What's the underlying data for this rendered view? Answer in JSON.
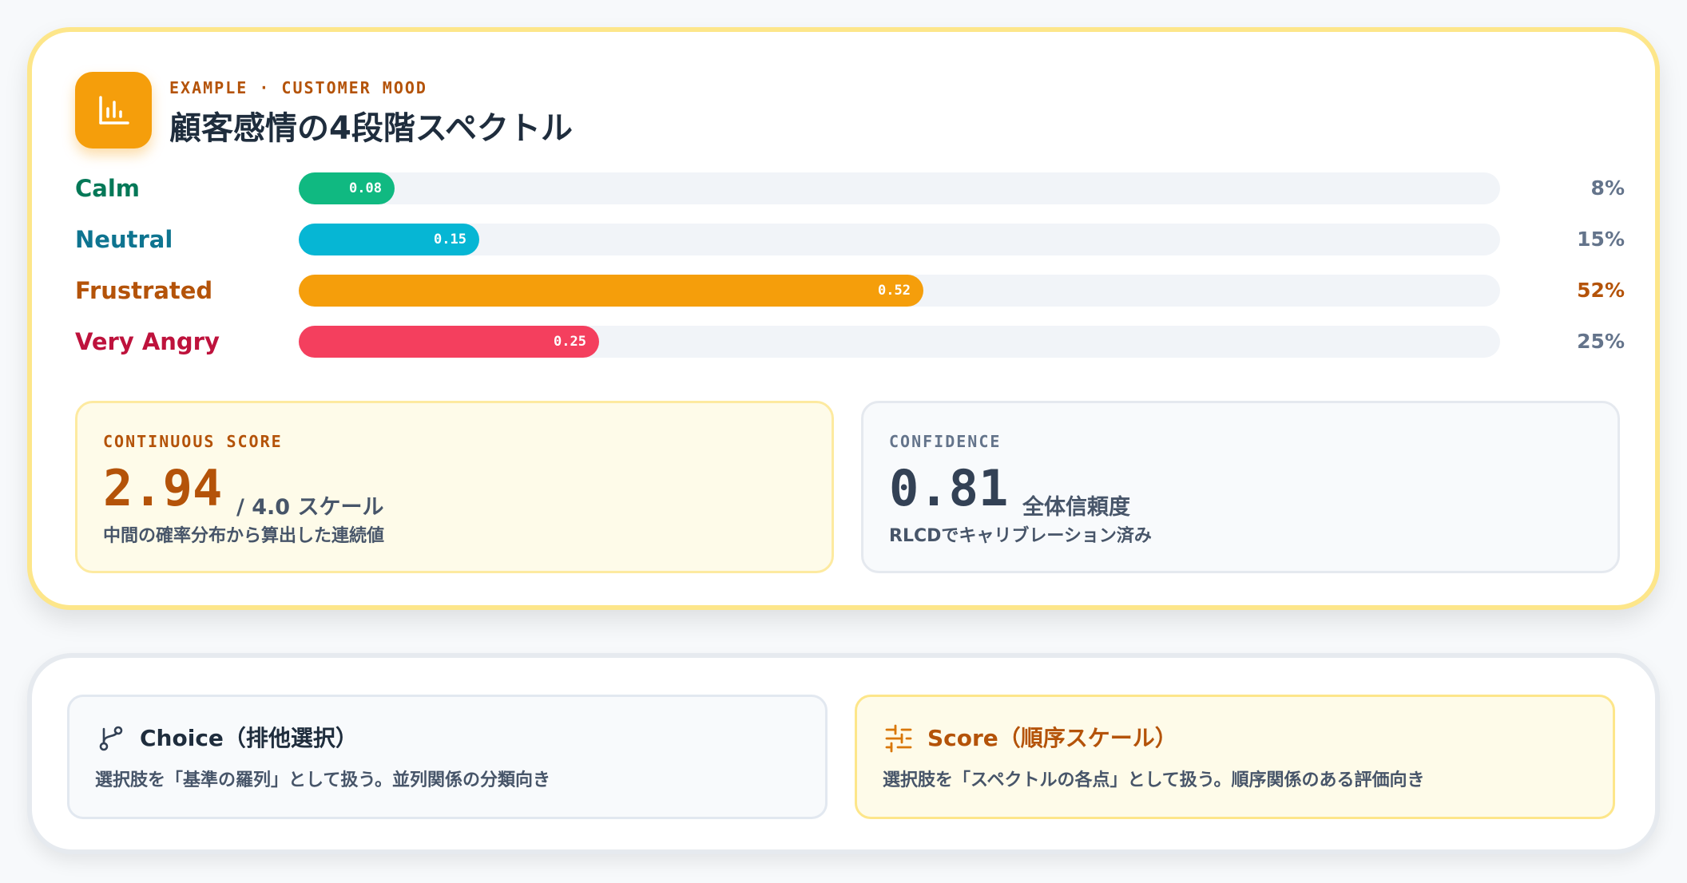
{
  "header": {
    "eyebrow": "EXAMPLE · CUSTOMER MOOD",
    "title": "顧客感情の4段階スペクトル",
    "icon": "bar-chart-icon"
  },
  "chart_data": {
    "type": "bar",
    "orientation": "horizontal",
    "categories": [
      "Calm",
      "Neutral",
      "Frustrated",
      "Very Angry"
    ],
    "values": [
      0.08,
      0.15,
      0.52,
      0.25
    ],
    "value_labels": [
      "0.08",
      "0.15",
      "0.52",
      "0.25"
    ],
    "percent_labels": [
      "8%",
      "15%",
      "52%",
      "25%"
    ],
    "xlim": [
      0,
      1
    ],
    "colors": [
      "#10b981",
      "#06b6d4",
      "#f59e0b",
      "#f43f5e"
    ],
    "label_colors": [
      "#047857",
      "#0e7490",
      "#b45309",
      "#be123c"
    ],
    "percent_colors": [
      "#64748b",
      "#64748b",
      "#b45309",
      "#64748b"
    ]
  },
  "score": {
    "label": "CONTINUOUS SCORE",
    "value": "2.94",
    "unit": "/ 4.0 スケール",
    "description": "中間の確率分布から算出した連続値"
  },
  "confidence": {
    "label": "CONFIDENCE",
    "value": "0.81",
    "unit": "全体信頼度",
    "description": "RLCDでキャリブレーション済み"
  },
  "modes": {
    "choice": {
      "icon": "branch-icon",
      "title": "Choice（排他選択）",
      "description": "選択肢を「基準の羅列」として扱う。並列関係の分類向き"
    },
    "score": {
      "icon": "sliders-icon",
      "title": "Score（順序スケール）",
      "description": "選択肢を「スペクトルの各点」として扱う。順序関係のある評価向き"
    }
  },
  "colors": {
    "accent": "#f59e0b",
    "accent_dark": "#b45309",
    "card_border": "#fde68a",
    "text_dark": "#1f2d3d",
    "text_muted": "#475569"
  }
}
